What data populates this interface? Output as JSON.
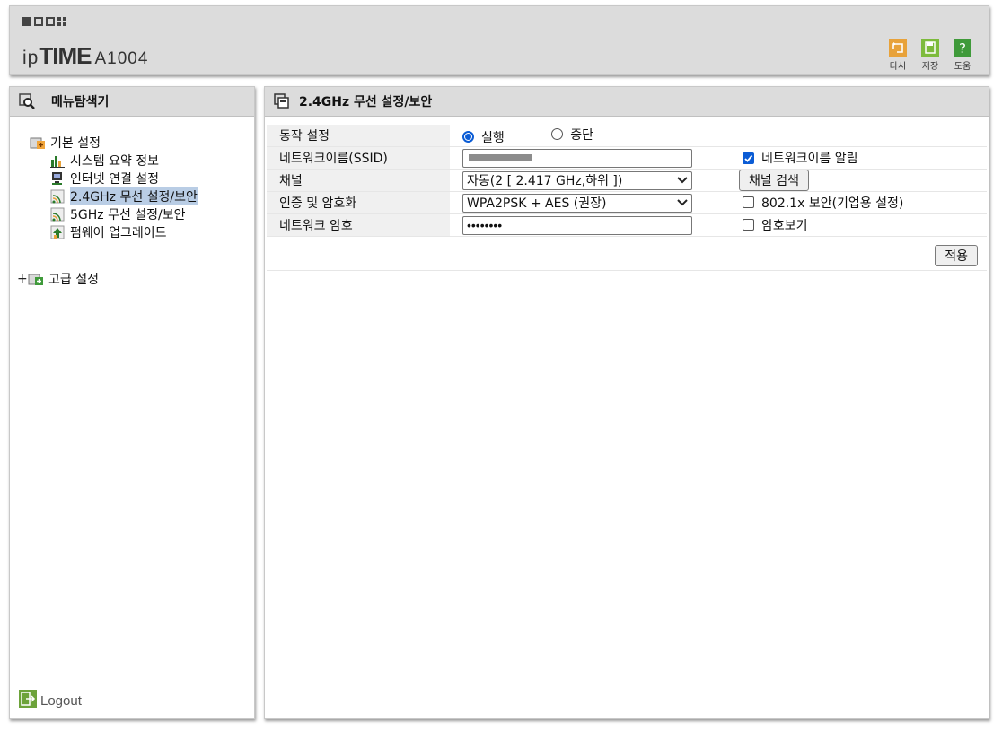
{
  "header": {
    "brand_ip": "ip",
    "brand_time": "TIME",
    "model": "A1004",
    "tools": [
      {
        "label": "다시",
        "icon": "undo-icon",
        "color": "#e8a23a"
      },
      {
        "label": "저장",
        "icon": "save-icon",
        "color": "#7dbb3c"
      },
      {
        "label": "도움",
        "icon": "help-icon",
        "color": "#3f9a3a"
      }
    ]
  },
  "sidebar": {
    "title": "메뉴탐색기",
    "groups": [
      {
        "label": "기본 설정",
        "expanded": true
      },
      {
        "label": "고급 설정",
        "expanded": false,
        "expander": "+"
      }
    ],
    "items": [
      {
        "label": "시스템 요약 정보",
        "icon": "chart-icon"
      },
      {
        "label": "인터넷 연결 설정",
        "icon": "monitor-icon"
      },
      {
        "label": "2.4GHz 무선 설정/보안",
        "icon": "wifi-icon",
        "active": true
      },
      {
        "label": "5GHz 무선 설정/보안",
        "icon": "wifi-icon"
      },
      {
        "label": "펌웨어 업그레이드",
        "icon": "upgrade-icon"
      }
    ],
    "logout": "Logout"
  },
  "main": {
    "title": "2.4GHz 무선 설정/보안",
    "rows": {
      "operation": {
        "label": "동작 설정",
        "opt_run": "실행",
        "opt_stop": "중단",
        "selected": "실행"
      },
      "ssid": {
        "label": "네트워크이름(SSID)",
        "value_masked": true,
        "announce_label": "네트워크이름 알림",
        "announce_checked": true
      },
      "channel": {
        "label": "채널",
        "value": "자동(2 [ 2.417 GHz,하위 ])",
        "scan_label": "채널 검색"
      },
      "auth": {
        "label": "인증 및 암호화",
        "value": "WPA2PSK + AES (권장)",
        "dot1x_label": "802.1x 보안(기업용 설정)",
        "dot1x_checked": false
      },
      "password": {
        "label": "네트워크 암호",
        "value": "••••••••",
        "show_label": "암호보기",
        "show_checked": false
      }
    },
    "apply_label": "적용"
  },
  "colors": {
    "accent": "#0b5cd5",
    "panel_header": "#dcdcdc",
    "active_item": "#b9cde5"
  }
}
